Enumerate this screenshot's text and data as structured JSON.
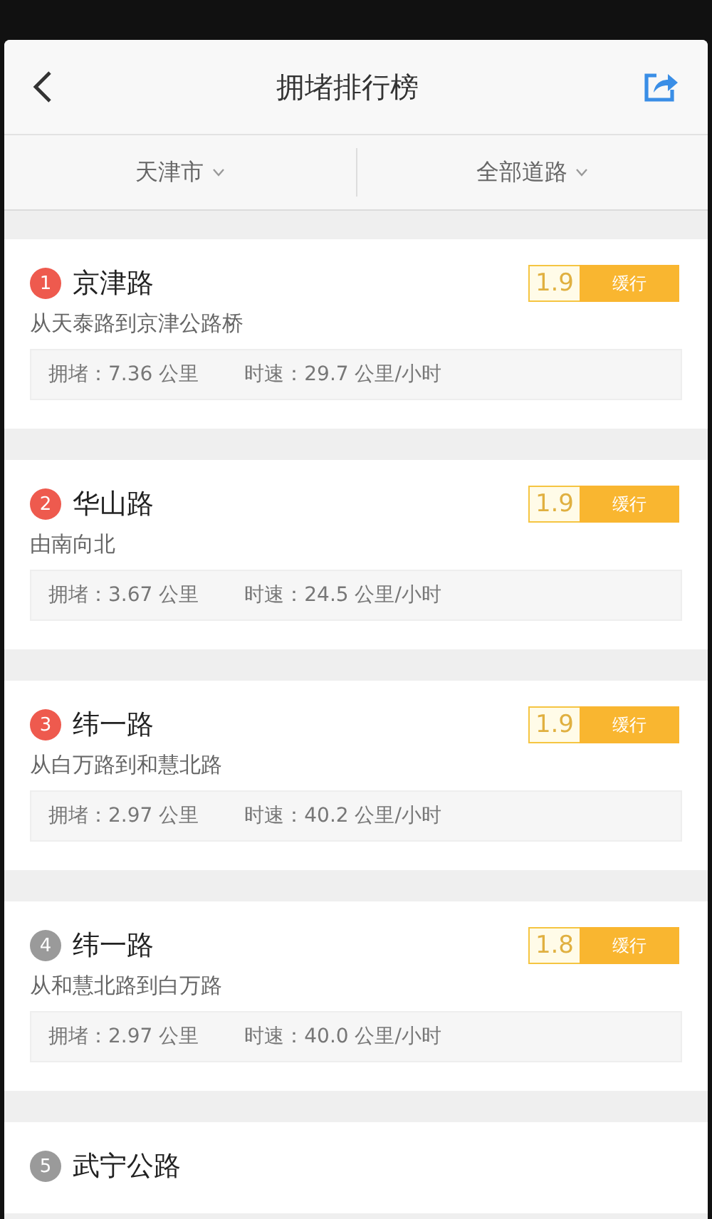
{
  "header": {
    "title": "拥堵排行榜"
  },
  "filters": [
    {
      "label": "天津市"
    },
    {
      "label": "全部道路"
    }
  ],
  "roads": [
    {
      "rank": "1",
      "color": "#ee5a4e",
      "name": "京津路",
      "section": "从天泰路到京津公路桥",
      "index": "1.9",
      "status": "缓行",
      "jam": "拥堵：7.36 公里",
      "speed": "时速：29.7 公里/小时"
    },
    {
      "rank": "2",
      "color": "#ee5a4e",
      "name": "华山路",
      "section": "由南向北",
      "index": "1.9",
      "status": "缓行",
      "jam": "拥堵：3.67 公里",
      "speed": "时速：24.5 公里/小时"
    },
    {
      "rank": "3",
      "color": "#ee5a4e",
      "name": "纬一路",
      "section": "从白万路到和慧北路",
      "index": "1.9",
      "status": "缓行",
      "jam": "拥堵：2.97 公里",
      "speed": "时速：40.2 公里/小时"
    },
    {
      "rank": "4",
      "color": "#9a9a9a",
      "name": "纬一路",
      "section": "从和慧北路到白万路",
      "index": "1.8",
      "status": "缓行",
      "jam": "拥堵：2.97 公里",
      "speed": "时速：40.0 公里/小时"
    },
    {
      "rank": "5",
      "color": "#9a9a9a",
      "name": "武宁公路"
    }
  ]
}
